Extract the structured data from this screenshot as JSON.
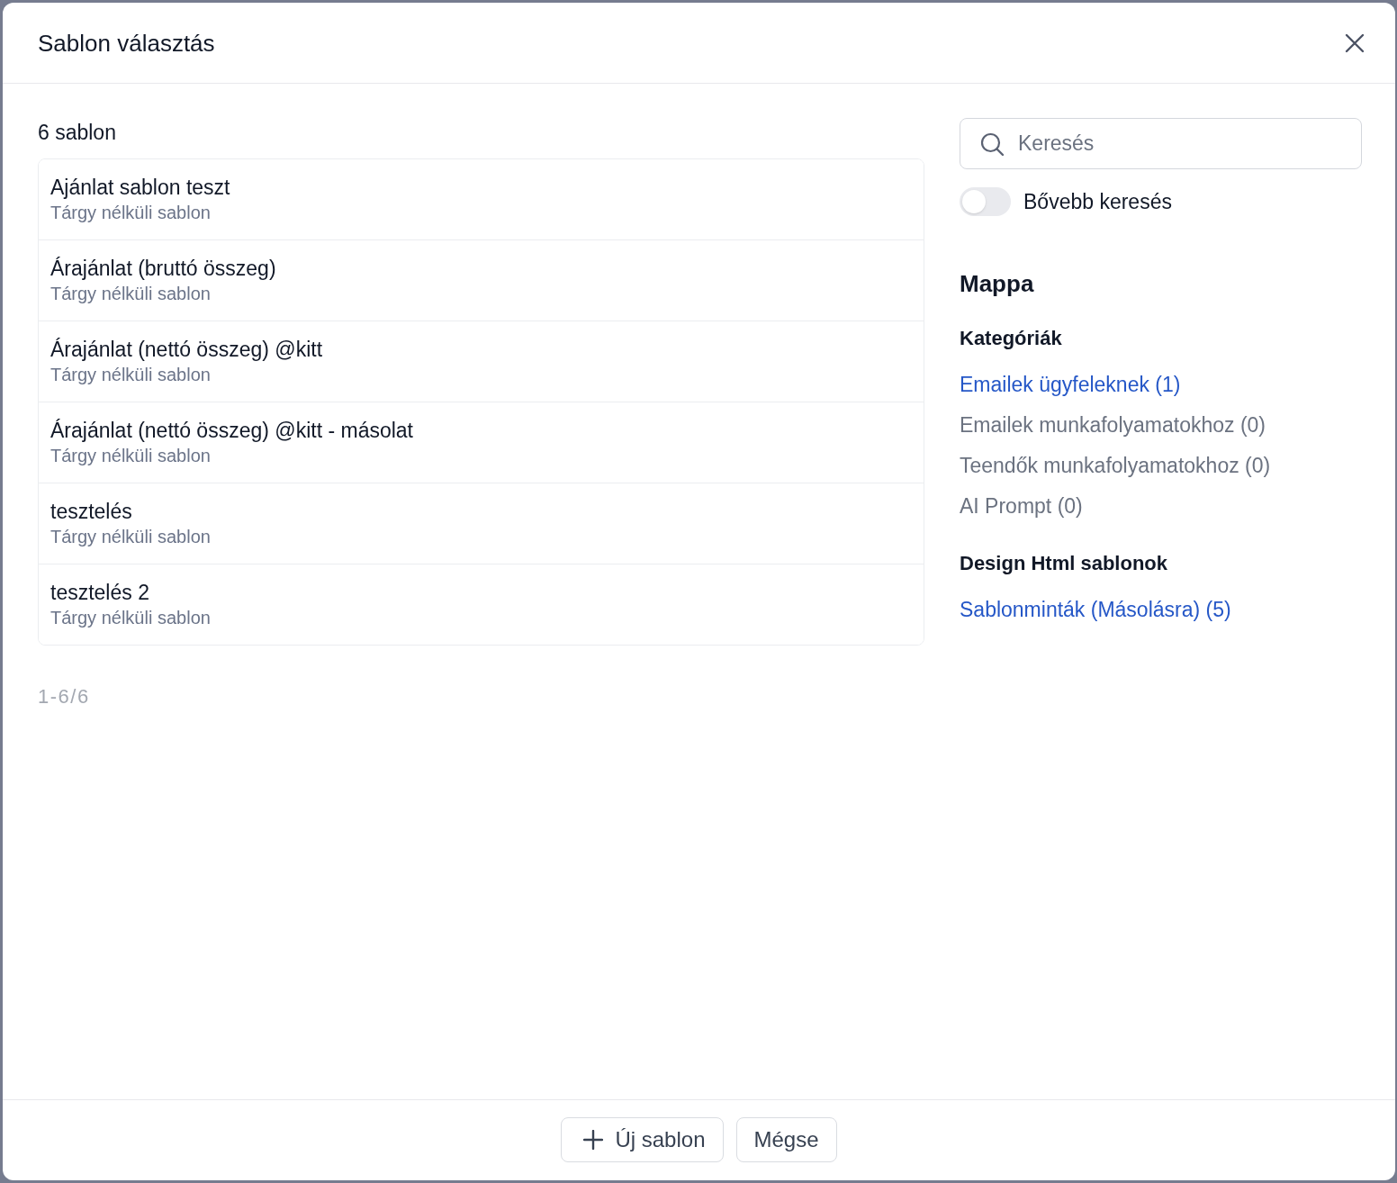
{
  "dialog": {
    "title": "Sablon választás"
  },
  "list": {
    "count_label": "6 sablon",
    "templates": [
      {
        "name": "Ajánlat sablon teszt",
        "subject": "Tárgy nélküli sablon"
      },
      {
        "name": "Árajánlat (bruttó összeg)",
        "subject": "Tárgy nélküli sablon"
      },
      {
        "name": "Árajánlat (nettó összeg) @kitt",
        "subject": "Tárgy nélküli sablon"
      },
      {
        "name": "Árajánlat (nettó összeg) @kitt - másolat",
        "subject": "Tárgy nélküli sablon"
      },
      {
        "name": "tesztelés",
        "subject": "Tárgy nélküli sablon"
      },
      {
        "name": "tesztelés 2",
        "subject": "Tárgy nélküli sablon"
      }
    ],
    "pagination": "1-6/6"
  },
  "search": {
    "placeholder": "Keresés"
  },
  "extended_search": {
    "label": "Bővebb keresés",
    "on": false
  },
  "folder": {
    "title": "Mappa",
    "groups": [
      {
        "title": "Kategóriák",
        "items": [
          {
            "label": "Emailek ügyfeleknek (1)",
            "disabled": false
          },
          {
            "label": "Emailek munkafolyamatokhoz (0)",
            "disabled": true
          },
          {
            "label": "Teendők munkafolyamatokhoz (0)",
            "disabled": true
          },
          {
            "label": "AI Prompt (0)",
            "disabled": true
          }
        ]
      },
      {
        "title": "Design Html sablonok",
        "items": [
          {
            "label": "Sablonminták (Másolásra) (5)",
            "disabled": false
          }
        ]
      }
    ]
  },
  "footer": {
    "buttons": [
      {
        "label": "Új sablon",
        "kind": "add"
      },
      {
        "label": "Mégse",
        "kind": "plain"
      }
    ]
  }
}
